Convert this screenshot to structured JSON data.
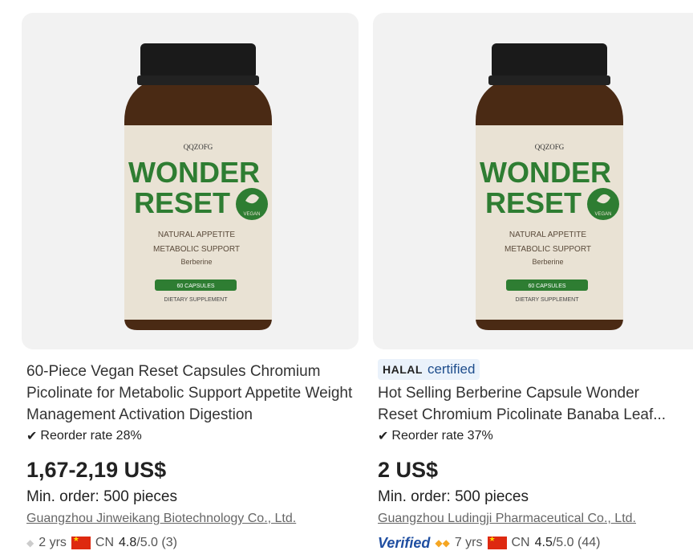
{
  "products": [
    {
      "label_brand": "QQZOFG",
      "label_title_1": "WONDER",
      "label_title_2": "RESET",
      "label_vegan": "VEGAN",
      "label_line_1": "NATURAL APPETITE",
      "label_line_2": "METABOLIC SUPPORT",
      "label_line_3": "Berberine",
      "label_count": "60 CAPSULES",
      "label_footer": "DIETARY SUPPLEMENT",
      "title": "60-Piece Vegan Reset Capsules Chromium Picolinate for Metabolic Support Appetite Weight Management Activation Digestion",
      "reorder": "Reorder rate 28%",
      "price": "1,67-2,19 US$",
      "moq": "Min. order: 500 pieces",
      "supplier": "Guangzhou Jinweikang Biotechnology Co., Ltd.",
      "years": "2 yrs",
      "country": "CN",
      "rating": "4.8",
      "rating_suffix": "/5.0 (3)"
    },
    {
      "label_brand": "QQZOFG",
      "label_title_1": "WONDER",
      "label_title_2": "RESET",
      "label_vegan": "VEGAN",
      "label_line_1": "NATURAL APPETITE",
      "label_line_2": "METABOLIC SUPPORT",
      "label_line_3": "Berberine",
      "label_count": "60 CAPSULES",
      "label_footer": "DIETARY SUPPLEMENT",
      "badge_halal": "HALAL",
      "badge_certified": "certified",
      "title_line_1": "Hot Selling Berberine Capsule Wonder",
      "title_line_2": "Reset Chromium Picolinate Banaba Leaf...",
      "reorder": "Reorder rate 37%",
      "price": "2 US$",
      "moq": "Min. order: 500 pieces",
      "supplier": "Guangzhou Ludingji Pharmaceutical Co., Ltd.",
      "verified": "Verified",
      "years": "7 yrs",
      "country": "CN",
      "rating": "4.5",
      "rating_suffix": "/5.0 (44)"
    }
  ],
  "colors": {
    "label_green": "#2e7d32",
    "bottle_amber": "#4a2a14",
    "verified_blue": "#1f4ea1"
  }
}
